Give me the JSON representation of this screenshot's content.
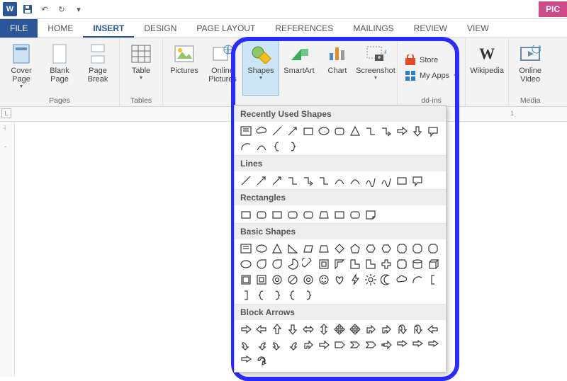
{
  "qat": {
    "undo": "↶",
    "redo": "↻"
  },
  "pic_tab": "PIC",
  "tabs": {
    "file": "FILE",
    "home": "HOME",
    "insert": "INSERT",
    "design": "DESIGN",
    "page_layout": "PAGE LAYOUT",
    "references": "REFERENCES",
    "mailings": "MAILINGS",
    "review": "REVIEW",
    "view": "VIEW"
  },
  "ribbon": {
    "pages": {
      "label": "Pages",
      "cover": "Cover Page",
      "blank": "Blank Page",
      "break": "Page Break"
    },
    "tables": {
      "label": "Tables",
      "table": "Table"
    },
    "illustrations": {
      "pictures": "Pictures",
      "online_pictures": "Online Pictures",
      "shapes": "Shapes",
      "smartart": "SmartArt",
      "chart": "Chart",
      "screenshot": "Screenshot"
    },
    "addins": {
      "label": "dd-ins",
      "store": "Store",
      "myapps": "My Apps"
    },
    "wikipedia": "Wikipedia",
    "media": {
      "label": "Media",
      "video": "Online Video"
    }
  },
  "ruler": {
    "left": "L",
    "n1": "1"
  },
  "gallery": {
    "recent": "Recently Used Shapes",
    "lines": "Lines",
    "rectangles": "Rectangles",
    "basic": "Basic Shapes",
    "block": "Block Arrows"
  }
}
